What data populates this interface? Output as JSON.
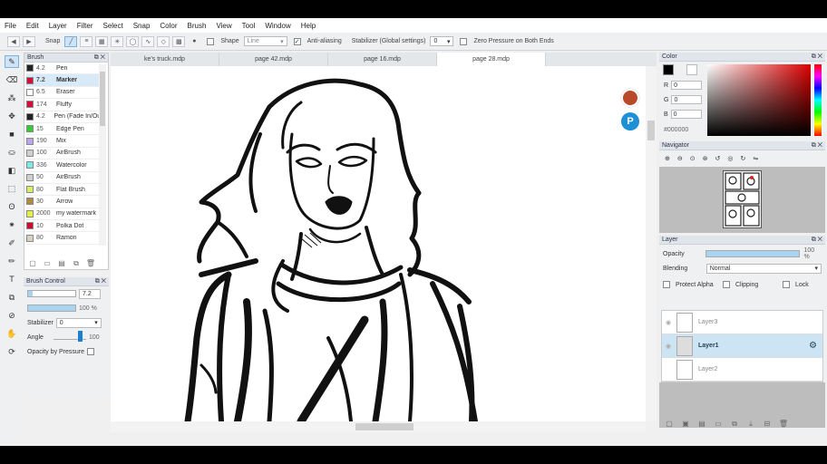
{
  "menu": [
    "File",
    "Edit",
    "Layer",
    "Filter",
    "Select",
    "Snap",
    "Color",
    "Brush",
    "View",
    "Tool",
    "Window",
    "Help"
  ],
  "toolbar": {
    "snap_label": "Snap",
    "shape_label": "Shape",
    "shape_value": "Line",
    "antialias_label": "Anti-aliasing",
    "stabilizer_label": "Stabilizer (Global settings)",
    "stabilizer_value": "0",
    "zero_pressure_label": "Zero Pressure on Both Ends"
  },
  "brush_panel": {
    "title": "Brush",
    "items": [
      {
        "size": "4.2",
        "name": "Pen",
        "color": "#222222"
      },
      {
        "size": "7.2",
        "name": "Marker",
        "color": "#d0103a",
        "selected": true
      },
      {
        "size": "6.5",
        "name": "Eraser",
        "color": "#ffffff"
      },
      {
        "size": "174",
        "name": "Fluffy",
        "color": "#d0103a"
      },
      {
        "size": "4.2",
        "name": "Pen (Fade In/Out)",
        "color": "#222222"
      },
      {
        "size": "15",
        "name": "Edge Pen",
        "color": "#33cc33"
      },
      {
        "size": "190",
        "name": "Mix",
        "color": "#b9a6ef"
      },
      {
        "size": "100",
        "name": "AirBrush",
        "color": "#cfcfcf"
      },
      {
        "size": "336",
        "name": "Watercolor",
        "color": "#7fe8e8"
      },
      {
        "size": "50",
        "name": "AirBrush",
        "color": "#cfcfcf"
      },
      {
        "size": "80",
        "name": "Flat Brush",
        "color": "#d5ee6a"
      },
      {
        "size": "30",
        "name": "Arrow",
        "color": "#b08a40"
      },
      {
        "size": "2000",
        "name": "my watermark",
        "color": "#e6f040"
      },
      {
        "size": "10",
        "name": "Polka Dot",
        "color": "#c8102e"
      },
      {
        "size": "80",
        "name": "Ramon",
        "color": "#d9d1c0"
      }
    ]
  },
  "brush_control": {
    "title": "Brush Control",
    "size_value": "7.2",
    "opacity_value": "100 %",
    "stabilizer_label": "Stabilizer",
    "stabilizer_value": "0",
    "angle_label": "Angle",
    "angle_value": "100",
    "opacity_pressure_label": "Opacity by Pressure"
  },
  "tabs": [
    {
      "label": "ke's truck.mdp"
    },
    {
      "label": "page 42.mdp"
    },
    {
      "label": "page 16.mdp"
    },
    {
      "label": "page 28.mdp",
      "active": true
    }
  ],
  "color_panel": {
    "title": "Color",
    "r_label": "R",
    "r_value": "0",
    "g_label": "G",
    "g_value": "0",
    "b_label": "B",
    "b_value": "0",
    "hex": "#000000",
    "current_color": "#000000"
  },
  "navigator": {
    "title": "Navigator"
  },
  "layer_panel": {
    "title": "Layer",
    "opacity_label": "Opacity",
    "opacity_value": "100 %",
    "blending_label": "Blending",
    "blending_value": "Normal",
    "protect_alpha_label": "Protect Alpha",
    "clipping_label": "Clipping",
    "lock_label": "Lock",
    "layers": [
      {
        "name": "Layer3"
      },
      {
        "name": "Layer1",
        "selected": true
      },
      {
        "name": "Layer2"
      }
    ]
  }
}
